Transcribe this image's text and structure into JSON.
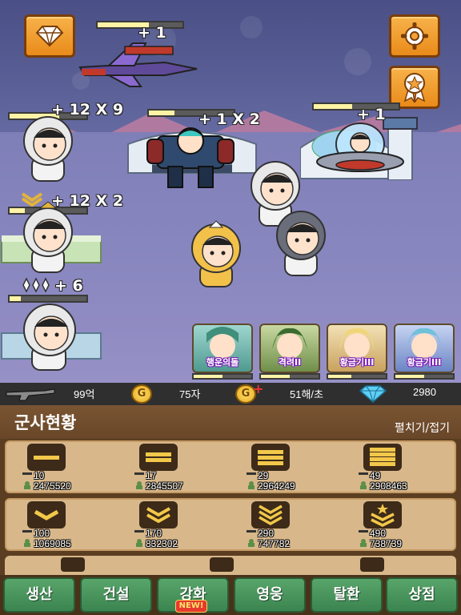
{
  "scene": {
    "reward_tags": [
      {
        "id": "plane",
        "text": "+ 1",
        "progress": 0.6
      },
      {
        "id": "soldier1",
        "text": "+ 12 X 9",
        "progress": 0.65
      },
      {
        "id": "mech",
        "text": "+ 1 X 2",
        "progress": 0.3
      },
      {
        "id": "ufo",
        "text": "+ 1",
        "progress": 0.45
      },
      {
        "id": "soldier2",
        "text": "+ 12 X 2",
        "progress": 0.2
      },
      {
        "id": "soldier3",
        "text": "+ 6",
        "progress": 0.15
      }
    ],
    "heroes": [
      {
        "name": "행운의돌",
        "progress": 0.5
      },
      {
        "name": "격려II",
        "progress": 0.5
      },
      {
        "name": "황금기III",
        "progress": 0.4
      },
      {
        "name": "황금기III",
        "progress": 0.5
      }
    ],
    "colors": {
      "accent_orange": "#f2a23a",
      "sky": "#5a5f96"
    }
  },
  "stats": {
    "weapon_count": "99억",
    "gold": "75자",
    "gold_rate": "51해/초",
    "gems": "2980",
    "coin_letter": "G"
  },
  "panel": {
    "title": "군사현황",
    "toggle_label": "펼치기/접기",
    "ranks": [
      {
        "insignia": "bar-1",
        "count": "10",
        "power": "2475520"
      },
      {
        "insignia": "bar-2",
        "count": "17",
        "power": "2845507"
      },
      {
        "insignia": "bar-3",
        "count": "29",
        "power": "2964249"
      },
      {
        "insignia": "bar-4",
        "count": "49",
        "power": "2908463"
      },
      {
        "insignia": "chevron-1",
        "count": "100",
        "power": "1069085"
      },
      {
        "insignia": "chevron-2",
        "count": "170",
        "power": "832302"
      },
      {
        "insignia": "chevron-3",
        "count": "290",
        "power": "747782"
      },
      {
        "insignia": "chevron-star",
        "count": "490",
        "power": "738739"
      }
    ]
  },
  "tabs": [
    {
      "label": "생산"
    },
    {
      "label": "건설"
    },
    {
      "label": "강화",
      "badge": "NEW!"
    },
    {
      "label": "영웅"
    },
    {
      "label": "탈환"
    },
    {
      "label": "상점"
    }
  ]
}
